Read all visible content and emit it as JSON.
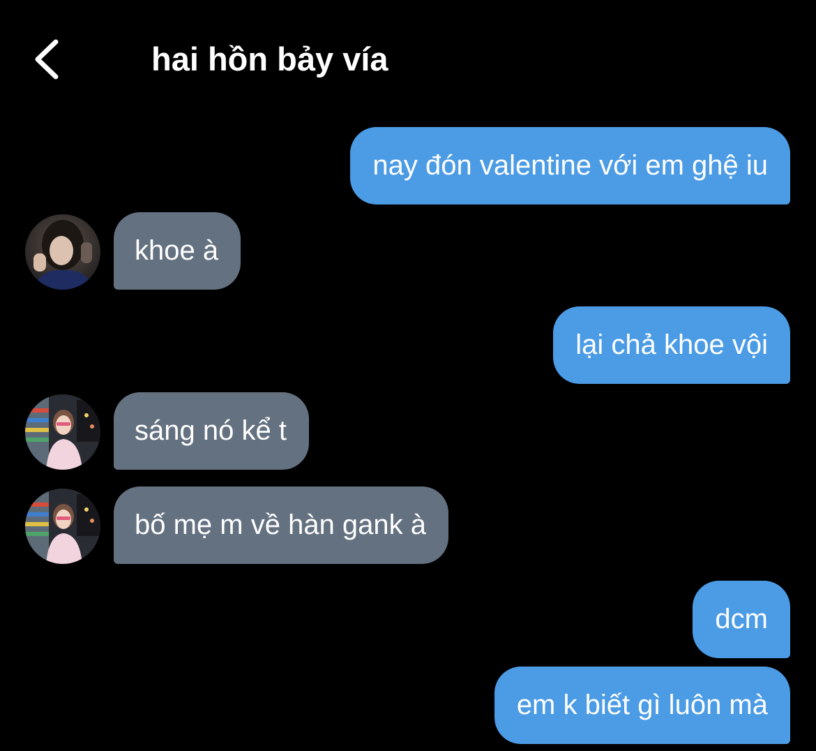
{
  "header": {
    "title": "hai hồn bảy vía",
    "back_icon": "chevron-left-icon"
  },
  "colors": {
    "background": "#000000",
    "outgoing_bubble": "#4b9be5",
    "incoming_bubble": "#647180",
    "text": "#ffffff"
  },
  "messages": [
    {
      "direction": "outgoing",
      "text": "nay đón valentine với em ghệ iu"
    },
    {
      "direction": "incoming",
      "text": "khoe à",
      "avatar": "avatar-dark-hair-photo"
    },
    {
      "direction": "outgoing",
      "text": "lại chả khoe vội"
    },
    {
      "direction": "incoming",
      "text": "sáng nó kể t",
      "avatar": "avatar-pink-outfit-photo"
    },
    {
      "direction": "incoming",
      "text": "bố mẹ m về hàn gank à",
      "avatar": "avatar-pink-outfit-photo"
    },
    {
      "direction": "outgoing",
      "text": "dcm"
    },
    {
      "direction": "outgoing",
      "text": "em k biết gì luôn mà"
    }
  ]
}
